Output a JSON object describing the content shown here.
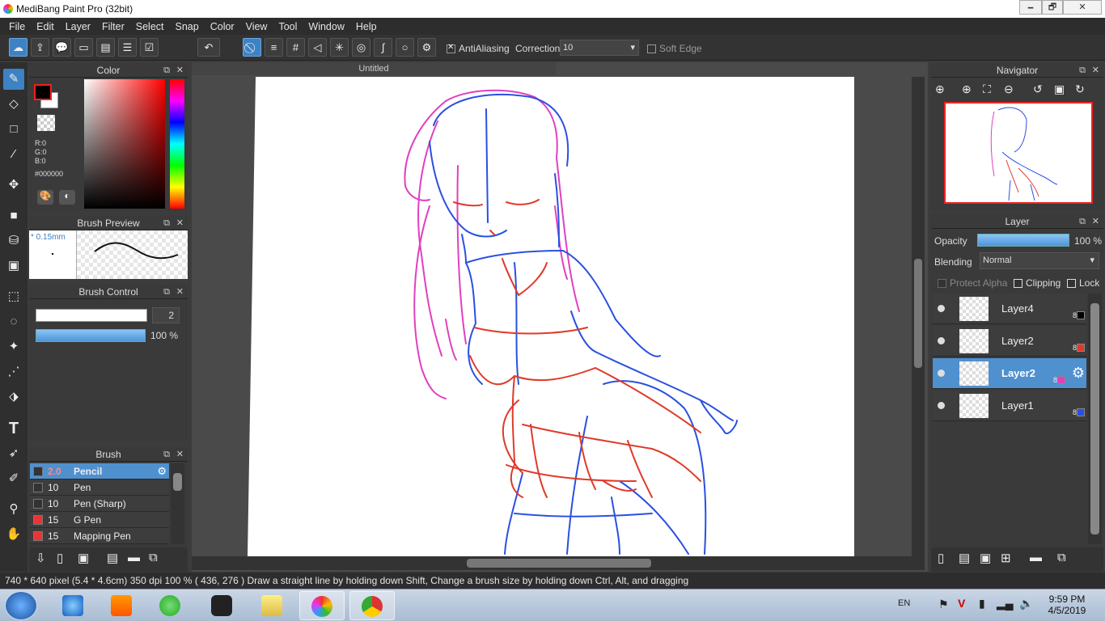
{
  "window": {
    "title": "MediBang Paint Pro (32bit)",
    "minimize": "🗕",
    "maximize": "🗗",
    "close": "✕"
  },
  "menu": [
    "File",
    "Edit",
    "Layer",
    "Filter",
    "Select",
    "Snap",
    "Color",
    "View",
    "Tool",
    "Window",
    "Help"
  ],
  "toolbar": {
    "antialiasing_label": "AntiAliasing",
    "correction_label": "Correction",
    "correction_value": "10",
    "soft_edge_label": "Soft Edge"
  },
  "color_panel": {
    "title": "Color",
    "r": "R:0",
    "g": "G:0",
    "b": "B:0",
    "hex": "#000000"
  },
  "brush_preview": {
    "title": "Brush Preview",
    "size": "* 0.15mm"
  },
  "brush_control": {
    "title": "Brush Control",
    "size_value": "2",
    "opacity_value": "100 %"
  },
  "brush_panel": {
    "title": "Brush",
    "items": [
      {
        "size": "2.0",
        "name": "Pencil",
        "color": "#333333"
      },
      {
        "size": "10",
        "name": "Pen",
        "color": "#333333"
      },
      {
        "size": "10",
        "name": "Pen (Sharp)",
        "color": "#333333"
      },
      {
        "size": "15",
        "name": "G Pen",
        "color": "#ee3333"
      },
      {
        "size": "15",
        "name": "Mapping Pen",
        "color": "#ee3333"
      }
    ]
  },
  "canvas": {
    "tab_title": "Untitled"
  },
  "navigator": {
    "title": "Navigator"
  },
  "layer_panel": {
    "title": "Layer",
    "opacity_label": "Opacity",
    "opacity_value": "100 %",
    "blending_label": "Blending",
    "blending_value": "Normal",
    "protect_alpha": "Protect Alpha",
    "clipping": "Clipping",
    "lock": "Lock",
    "layers": [
      {
        "name": "Layer4",
        "num": "8",
        "color": "#000000"
      },
      {
        "name": "Layer2",
        "num": "8",
        "color": "#e03a2a"
      },
      {
        "name": "Layer2",
        "num": "8",
        "color": "#e040c0"
      },
      {
        "name": "Layer1",
        "num": "8",
        "color": "#2a50e0"
      }
    ]
  },
  "status": {
    "text": "740 * 640 pixel   (5.4 * 4.6cm)  350 dpi   100 %   ( 436, 276 )   Draw a straight line by holding down Shift, Change a brush size by holding down Ctrl, Alt, and dragging"
  },
  "taskbar": {
    "lang": "EN",
    "time": "9:59 PM",
    "date": "4/5/2019"
  },
  "colors": {
    "accent": "#4f90cf",
    "pink": "#e040c0",
    "red": "#e03a2a",
    "blue": "#2a50e0"
  }
}
